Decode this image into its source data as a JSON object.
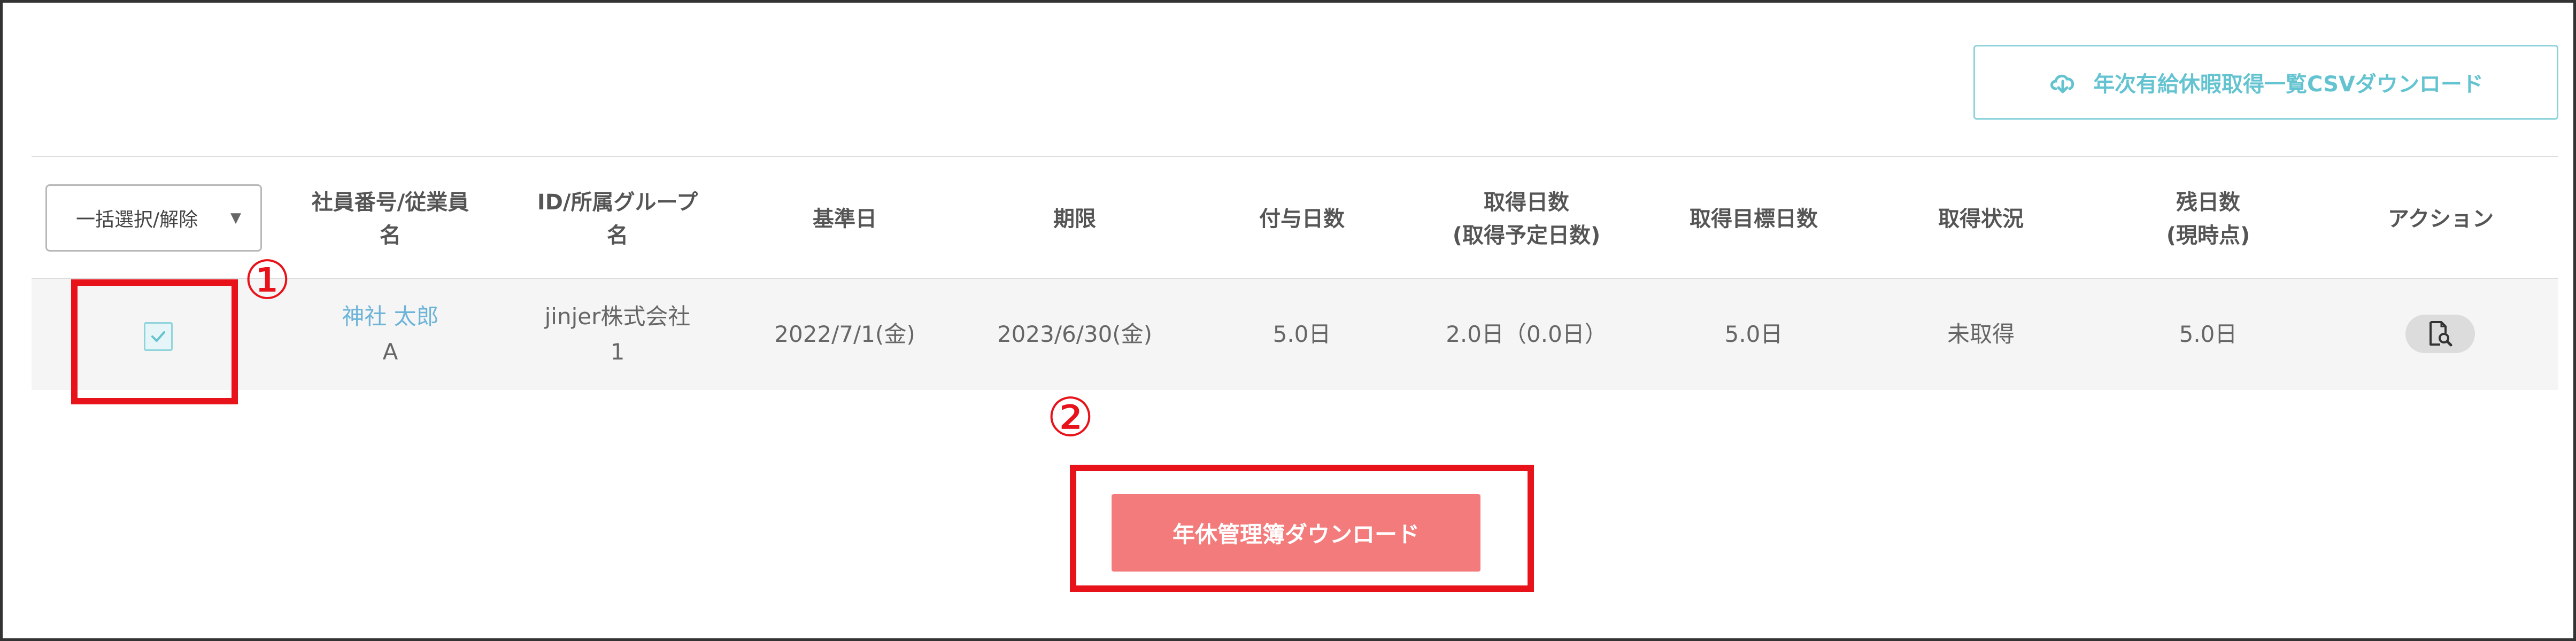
{
  "toolbar": {
    "csv_download_label": "年次有給休暇取得一覧CSVダウンロード"
  },
  "table": {
    "bulk_select_label": "一括選択/解除",
    "headers": {
      "employee_line1": "社員番号/従業員",
      "employee_line2": "名",
      "group_line1": "ID/所属グループ",
      "group_line2": "名",
      "base_date": "基準日",
      "deadline": "期限",
      "granted_days": "付与日数",
      "taken_line1": "取得日数",
      "taken_line2": "(取得予定日数)",
      "target_days": "取得目標日数",
      "status": "取得状況",
      "remaining_line1": "残日数",
      "remaining_line2": "(現時点)",
      "action": "アクション"
    },
    "rows": [
      {
        "checked": true,
        "employee_name": "神社 太郎",
        "employee_sub": "A",
        "group_line1": "jinjer株式会社",
        "group_line2": "1",
        "base_date": "2022/7/1(金)",
        "deadline": "2023/6/30(金)",
        "granted_days": "5.0日",
        "taken_days": "2.0日（0.0日）",
        "target_days": "5.0日",
        "status": "未取得",
        "remaining_days": "5.0日"
      }
    ]
  },
  "footer": {
    "annual_leave_download_label": "年休管理簿ダウンロード"
  },
  "annotations": {
    "step1": "①",
    "step2": "②",
    "highlight_color": "#e8131a"
  },
  "colors": {
    "accent": "#63c3d0",
    "link": "#6db4d8",
    "download_button": "#f47b7b"
  },
  "icons": {
    "csv": "cloud-download-icon",
    "checkbox": "check-icon",
    "action": "document-search-icon",
    "select": "caret-down-icon"
  }
}
